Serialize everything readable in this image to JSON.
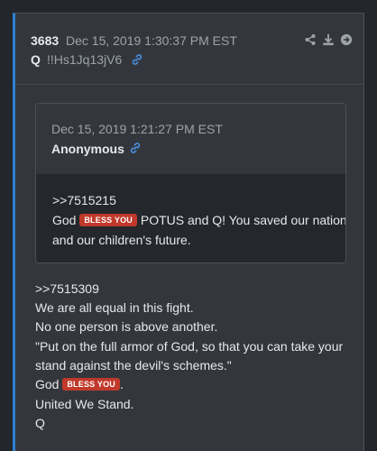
{
  "post": {
    "number": "3683",
    "date": "Dec 15, 2019 1:30:37 PM EST",
    "author": "Q",
    "tripcode": "!!Hs1Jq13jV6",
    "icons": [
      "share-icon",
      "download-icon",
      "arrow-right-icon",
      "link-icon"
    ]
  },
  "quote": {
    "date": "Dec 15, 2019 1:21:27 PM EST",
    "author": "Anonymous",
    "ref": ">>7515215",
    "line2_pre": "God",
    "badge": "BLESS YOU",
    "line2_post": "POTUS and Q! You saved our nation",
    "line3": "and our children's future."
  },
  "body": {
    "lines": [
      ">>7515309",
      "We are all equal in this fight.",
      "No one person is above another.",
      "\"Put on the full armor of God, so that you can take your",
      "stand against the devil's schemes.\""
    ],
    "god_pre": "God",
    "badge": "BLESS YOU",
    "god_post": ".",
    "line_united": "United We Stand.",
    "sign": "Q"
  },
  "colors": {
    "accent_border": "#2f80d1",
    "badge": "#c0392b",
    "link": "#4a90e2"
  }
}
